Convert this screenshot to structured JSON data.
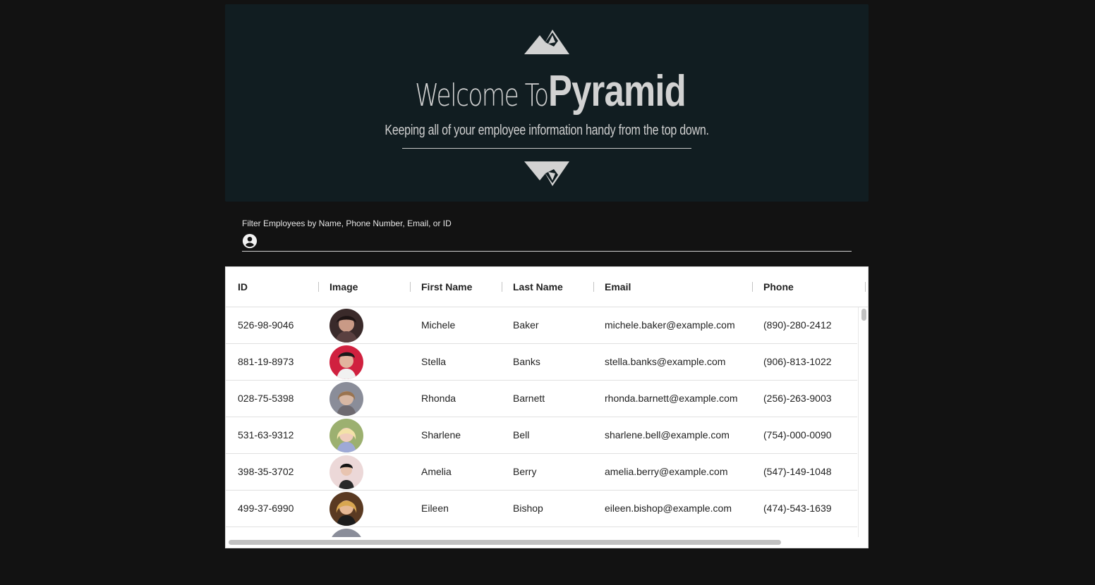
{
  "hero": {
    "title_light": "Welcome To",
    "title_bold": "Pyramid",
    "subtitle": "Keeping all of your employee information handy from the top down.",
    "logo_icon": "pyramid-logo-icon",
    "background": "#111d21"
  },
  "filter": {
    "label": "Filter Employees by Name, Phone Number, Email, or ID",
    "value": "",
    "placeholder": "",
    "icon": "account-circle-icon"
  },
  "table": {
    "columns": [
      "ID",
      "Image",
      "First Name",
      "Last Name",
      "Email",
      "Phone"
    ],
    "rows": [
      {
        "id": "526-98-9046",
        "first": "Michele",
        "last": "Baker",
        "email": "michele.baker@example.com",
        "phone": "(890)-280-2412",
        "avatar_color": "#3a2a2a"
      },
      {
        "id": "881-19-8973",
        "first": "Stella",
        "last": "Banks",
        "email": "stella.banks@example.com",
        "phone": "(906)-813-1022",
        "avatar_color": "#d0213f"
      },
      {
        "id": "028-75-5398",
        "first": "Rhonda",
        "last": "Barnett",
        "email": "rhonda.barnett@example.com",
        "phone": "(256)-263-9003",
        "avatar_color": "#8a8d99"
      },
      {
        "id": "531-63-9312",
        "first": "Sharlene",
        "last": "Bell",
        "email": "sharlene.bell@example.com",
        "phone": "(754)-000-0090",
        "avatar_color": "#d6c6a0"
      },
      {
        "id": "398-35-3702",
        "first": "Amelia",
        "last": "Berry",
        "email": "amelia.berry@example.com",
        "phone": "(547)-149-1048",
        "avatar_color": "#ecd8d8"
      },
      {
        "id": "499-37-6990",
        "first": "Eileen",
        "last": "Bishop",
        "email": "eileen.bishop@example.com",
        "phone": "(474)-543-1639",
        "avatar_color": "#b07a3c"
      },
      {
        "id": "",
        "first": "",
        "last": "",
        "email": "",
        "phone": "",
        "avatar_color": "#8a8d99"
      }
    ]
  }
}
